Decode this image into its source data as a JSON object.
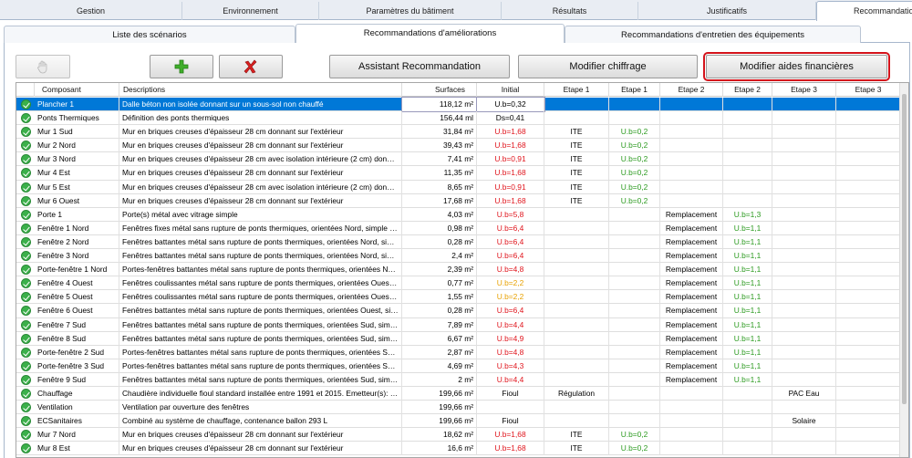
{
  "top_tabs": [
    "Gestion",
    "Environnement",
    "Paramètres du bâtiment",
    "Résultats",
    "Justificatifs",
    "Recommandations"
  ],
  "sub_tabs": [
    "Liste des scénarios",
    "Recommandations d'améliorations",
    "Recommandations d'entretien des équipements"
  ],
  "toolbar": {
    "assistant": "Assistant Recommandation",
    "modifier_chiffrage": "Modifier chiffrage",
    "modifier_aides": "Modifier aides financières"
  },
  "columns": [
    "Composant",
    "Descriptions",
    "Surfaces",
    "Initial",
    "Etape 1",
    "Etape 1",
    "Etape 2",
    "Etape 2",
    "Etape 3",
    "Etape 3"
  ],
  "rows": [
    {
      "c": "Plancher  1",
      "d": "Dalle béton non isolée donnant sur un sous-sol non chauffé",
      "s": "118,12 m²",
      "i": "U.b=0,32",
      "ic": "",
      "e1a": "",
      "e1b": "",
      "e2a": "",
      "e2b": "",
      "e3a": "",
      "e3b": ""
    },
    {
      "c": "Ponts Thermiques",
      "d": "Définition des ponts thermiques",
      "s": "156,44 ml",
      "i": "Ds=0,41",
      "ic": "",
      "e1a": "",
      "e1b": "",
      "e2a": "",
      "e2b": "",
      "e3a": "",
      "e3b": ""
    },
    {
      "c": "Mur  1 Sud",
      "d": "Mur en briques creuses d'épaisseur 28 cm donnant sur l'extérieur",
      "s": "31,84 m²",
      "i": "U.b=1,68",
      "ic": "red",
      "e1a": "ITE",
      "e1b": "U.b=0,2",
      "e2a": "",
      "e2b": "",
      "e3a": "",
      "e3b": ""
    },
    {
      "c": "Mur  2 Nord",
      "d": "Mur en briques creuses d'épaisseur 28 cm donnant sur l'extérieur",
      "s": "39,43 m²",
      "i": "U.b=1,68",
      "ic": "red",
      "e1a": "ITE",
      "e1b": "U.b=0,2",
      "e2a": "",
      "e2b": "",
      "e3a": "",
      "e3b": ""
    },
    {
      "c": "Mur  3 Nord",
      "d": "Mur en briques creuses d'épaisseur 28 cm avec isolation intérieure (2 cm) donnant...",
      "s": "7,41 m²",
      "i": "U.b=0,91",
      "ic": "red",
      "e1a": "ITE",
      "e1b": "U.b=0,2",
      "e2a": "",
      "e2b": "",
      "e3a": "",
      "e3b": ""
    },
    {
      "c": "Mur  4 Est",
      "d": "Mur en briques creuses d'épaisseur 28 cm donnant sur l'extérieur",
      "s": "11,35 m²",
      "i": "U.b=1,68",
      "ic": "red",
      "e1a": "ITE",
      "e1b": "U.b=0,2",
      "e2a": "",
      "e2b": "",
      "e3a": "",
      "e3b": ""
    },
    {
      "c": "Mur  5 Est",
      "d": "Mur en briques creuses d'épaisseur 28 cm avec isolation intérieure (2 cm) donnant...",
      "s": "8,65 m²",
      "i": "U.b=0,91",
      "ic": "red",
      "e1a": "ITE",
      "e1b": "U.b=0,2",
      "e2a": "",
      "e2b": "",
      "e3a": "",
      "e3b": ""
    },
    {
      "c": "Mur  6 Ouest",
      "d": "Mur en briques creuses d'épaisseur 28 cm donnant sur l'extérieur",
      "s": "17,68 m²",
      "i": "U.b=1,68",
      "ic": "red",
      "e1a": "ITE",
      "e1b": "U.b=0,2",
      "e2a": "",
      "e2b": "",
      "e3a": "",
      "e3b": ""
    },
    {
      "c": "Porte  1",
      "d": "Porte(s) métal avec vitrage simple",
      "s": "4,03 m²",
      "i": "U.b=5,8",
      "ic": "red",
      "e1a": "",
      "e1b": "",
      "e2a": "Remplacement",
      "e2b": "U.b=1,3",
      "e3a": "",
      "e3b": ""
    },
    {
      "c": "Fenêtre  1 Nord",
      "d": "Fenêtres fixes métal sans rupture de ponts thermiques, orientées Nord, simple vitr...",
      "s": "0,98 m²",
      "i": "U.b=6,4",
      "ic": "red",
      "e1a": "",
      "e1b": "",
      "e2a": "Remplacement",
      "e2b": "U.b=1,1",
      "e3a": "",
      "e3b": ""
    },
    {
      "c": "Fenêtre  2 Nord",
      "d": "Fenêtres battantes métal sans rupture de ponts thermiques, orientées Nord, simpl...",
      "s": "0,28 m²",
      "i": "U.b=6,4",
      "ic": "red",
      "e1a": "",
      "e1b": "",
      "e2a": "Remplacement",
      "e2b": "U.b=1,1",
      "e3a": "",
      "e3b": ""
    },
    {
      "c": "Fenêtre  3 Nord",
      "d": "Fenêtres battantes métal sans rupture de ponts thermiques, orientées Nord, simpl...",
      "s": "2,4 m²",
      "i": "U.b=6,4",
      "ic": "red",
      "e1a": "",
      "e1b": "",
      "e2a": "Remplacement",
      "e2b": "U.b=1,1",
      "e3a": "",
      "e3b": ""
    },
    {
      "c": "Porte-fenêtre  1 Nord",
      "d": "Portes-fenêtres battantes métal sans rupture de ponts thermiques, orientées Nord,...",
      "s": "2,39 m²",
      "i": "U.b=4,8",
      "ic": "red",
      "e1a": "",
      "e1b": "",
      "e2a": "Remplacement",
      "e2b": "U.b=1,1",
      "e3a": "",
      "e3b": ""
    },
    {
      "c": "Fenêtre  4 Ouest",
      "d": "Fenêtres coulissantes métal sans rupture de ponts thermiques, orientées Ouest, do...",
      "s": "0,77 m²",
      "i": "U.b=2,2",
      "ic": "orange",
      "e1a": "",
      "e1b": "",
      "e2a": "Remplacement",
      "e2b": "U.b=1,1",
      "e3a": "",
      "e3b": ""
    },
    {
      "c": "Fenêtre  5 Ouest",
      "d": "Fenêtres coulissantes métal sans rupture de ponts thermiques, orientées Ouest, do...",
      "s": "1,55 m²",
      "i": "U.b=2,2",
      "ic": "orange",
      "e1a": "",
      "e1b": "",
      "e2a": "Remplacement",
      "e2b": "U.b=1,1",
      "e3a": "",
      "e3b": ""
    },
    {
      "c": "Fenêtre  6 Ouest",
      "d": "Fenêtres battantes métal sans rupture de ponts thermiques, orientées Ouest, simp...",
      "s": "0,28 m²",
      "i": "U.b=6,4",
      "ic": "red",
      "e1a": "",
      "e1b": "",
      "e2a": "Remplacement",
      "e2b": "U.b=1,1",
      "e3a": "",
      "e3b": ""
    },
    {
      "c": "Fenêtre  7 Sud",
      "d": "Fenêtres battantes métal sans rupture de ponts thermiques, orientées Sud, simple ...",
      "s": "7,89 m²",
      "i": "U.b=4,4",
      "ic": "red",
      "e1a": "",
      "e1b": "",
      "e2a": "Remplacement",
      "e2b": "U.b=1,1",
      "e3a": "",
      "e3b": ""
    },
    {
      "c": "Fenêtre  8 Sud",
      "d": "Fenêtres battantes métal sans rupture de ponts thermiques, orientées Sud, simp...",
      "s": "6,67 m²",
      "i": "U.b=4,9",
      "ic": "red",
      "e1a": "",
      "e1b": "",
      "e2a": "Remplacement",
      "e2b": "U.b=1,1",
      "e3a": "",
      "e3b": ""
    },
    {
      "c": "Porte-fenêtre  2 Sud",
      "d": "Portes-fenêtres battantes métal sans rupture de ponts thermiques, orientées Sud, s...",
      "s": "2,87 m²",
      "i": "U.b=4,8",
      "ic": "red",
      "e1a": "",
      "e1b": "",
      "e2a": "Remplacement",
      "e2b": "U.b=1,1",
      "e3a": "",
      "e3b": ""
    },
    {
      "c": "Porte-fenêtre  3 Sud",
      "d": "Portes-fenêtres battantes métal sans rupture de ponts thermiques, orientées Sud, s...",
      "s": "4,69 m²",
      "i": "U.b=4,3",
      "ic": "red",
      "e1a": "",
      "e1b": "",
      "e2a": "Remplacement",
      "e2b": "U.b=1,1",
      "e3a": "",
      "e3b": ""
    },
    {
      "c": "Fenêtre  9 Sud",
      "d": "Fenêtres battantes métal sans rupture de ponts thermiques, orientées Sud, simple ...",
      "s": "2 m²",
      "i": "U.b=4,4",
      "ic": "red",
      "e1a": "",
      "e1b": "",
      "e2a": "Remplacement",
      "e2b": "U.b=1,1",
      "e3a": "",
      "e3b": ""
    },
    {
      "c": "Chauffage",
      "d": "Chaudière individuelle fioul standard installée entre 1991 et 2015. Emetteur(s): radi...",
      "s": "199,66 m²",
      "i": "Fioul",
      "ic": "",
      "e1a": "Régulation",
      "e1b": "",
      "e2a": "",
      "e2b": "",
      "e3a": "PAC Eau",
      "e3b": ""
    },
    {
      "c": "Ventilation",
      "d": "Ventilation par ouverture des fenêtres",
      "s": "199,66 m²",
      "i": "",
      "ic": "",
      "e1a": "",
      "e1b": "",
      "e2a": "",
      "e2b": "",
      "e3a": "",
      "e3b": ""
    },
    {
      "c": "ECSanitaires",
      "d": "Combiné au système de chauffage, contenance ballon 293 L",
      "s": "199,66 m²",
      "i": "Fioul",
      "ic": "",
      "e1a": "",
      "e1b": "",
      "e2a": "",
      "e2b": "",
      "e3a": "Solaire",
      "e3b": ""
    },
    {
      "c": "Mur  7 Nord",
      "d": "Mur en briques creuses d'épaisseur 28 cm donnant sur l'extérieur",
      "s": "18,62 m²",
      "i": "U.b=1,68",
      "ic": "red",
      "e1a": "ITE",
      "e1b": "U.b=0,2",
      "e2a": "",
      "e2b": "",
      "e3a": "",
      "e3b": ""
    },
    {
      "c": "Mur  8 Est",
      "d": "Mur en briques creuses d'épaisseur 28 cm donnant sur l'extérieur",
      "s": "16,6 m²",
      "i": "U.b=1,68",
      "ic": "red",
      "e1a": "ITE",
      "e1b": "U.b=0,2",
      "e2a": "",
      "e2b": "",
      "e3a": "",
      "e3b": ""
    }
  ]
}
